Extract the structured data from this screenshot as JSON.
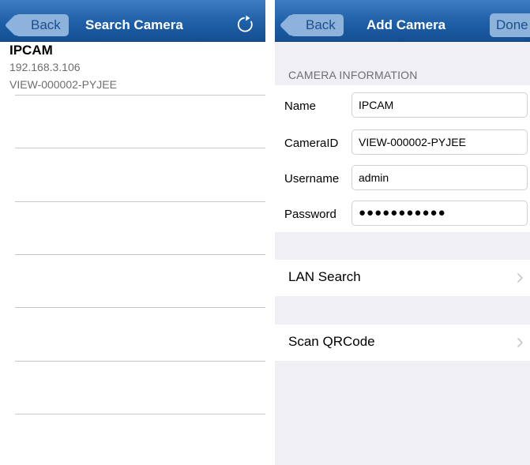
{
  "left_screen": {
    "back_label": "Back",
    "title": "Search Camera",
    "refresh_icon": "refresh-icon",
    "results": [
      {
        "name": "IPCAM",
        "ip": "192.168.3.106",
        "camera_id": "VIEW-000002-PYJEE"
      }
    ]
  },
  "right_screen": {
    "back_label": "Back",
    "title": "Add Camera",
    "done_label": "Done",
    "section_header": "CAMERA INFORMATION",
    "fields": [
      {
        "label": "Name",
        "value": "IPCAM"
      },
      {
        "label": "CameraID",
        "value": "VIEW-000002-PYJEE"
      },
      {
        "label": "Username",
        "value": "admin"
      },
      {
        "label": "Password",
        "value": "●●●●●●●●●●●"
      }
    ],
    "rows": [
      {
        "label": "LAN Search",
        "icon": "chevron-right-icon"
      },
      {
        "label": "Scan QRCode",
        "icon": "chevron-right-icon"
      }
    ]
  },
  "colors": {
    "nav_bar": "#1f5fa7",
    "nav_button": "#8db2dc",
    "grouped_background": "#efeff4"
  }
}
